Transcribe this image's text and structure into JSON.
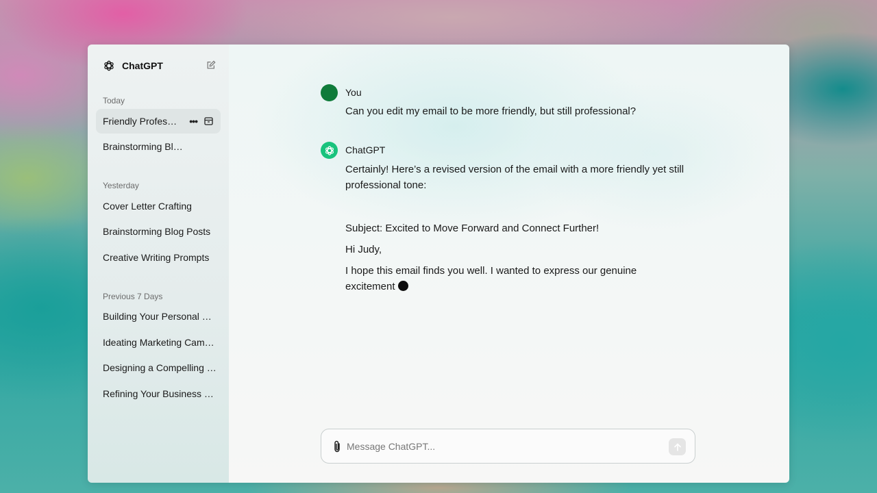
{
  "app": {
    "title": "ChatGPT"
  },
  "sidebar": {
    "sections": [
      {
        "label": "Today",
        "items": [
          "Friendly Professional Email Edit",
          "Brainstorming Blog Ideas"
        ]
      },
      {
        "label": "Yesterday",
        "items": [
          "Cover Letter Crafting",
          "Brainstorming Blog Posts",
          "Creative Writing Prompts"
        ]
      },
      {
        "label": "Previous 7 Days",
        "items": [
          "Building Your Personal Brand",
          "Ideating Marketing Campaigns",
          "Designing a Compelling Pitch",
          "Refining Your Business Plan"
        ]
      }
    ]
  },
  "conversation": {
    "user": {
      "name": "You",
      "text": "Can you edit my email to be more friendly, but still professional?"
    },
    "assistant": {
      "name": "ChatGPT",
      "intro": "Certainly! Here’s a revised version of the email with a more friendly yet still professional tone:",
      "subject": "Subject: Excited to Move Forward and Connect Further!",
      "greeting": "Hi Judy,",
      "body": "I hope this email finds you well. I wanted to express our genuine excitement"
    }
  },
  "composer": {
    "placeholder": "Message ChatGPT..."
  },
  "colors": {
    "user_avatar": "#0f7b3a",
    "assistant_avatar": "#19c37d"
  }
}
